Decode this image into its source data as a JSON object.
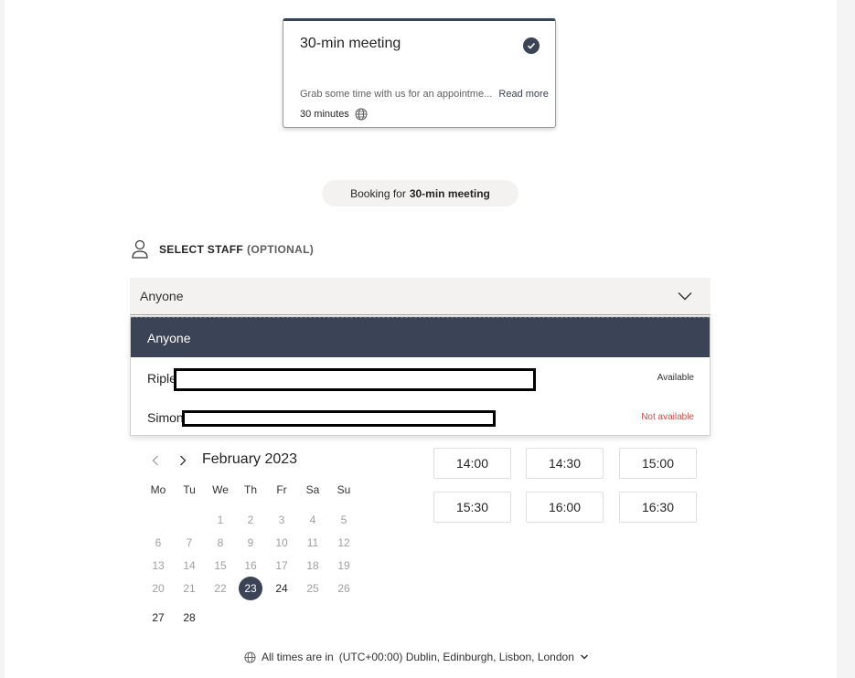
{
  "service": {
    "title": "30-min meeting",
    "description": "Grab some time with us for an appointme...",
    "read_more": "Read more",
    "duration": "30 minutes"
  },
  "booking": {
    "prefix": "Booking for",
    "service_name": "30-min meeting"
  },
  "staff": {
    "title": "SELECT STAFF",
    "optional": "(OPTIONAL)",
    "selected_value": "Anyone",
    "options": [
      {
        "label": "Anyone",
        "status": ""
      },
      {
        "label": "Riple",
        "status": "Available"
      },
      {
        "label": "Simon",
        "status": "Not available"
      }
    ]
  },
  "calendar": {
    "month": "February 2023",
    "weekdays": [
      "Mo",
      "Tu",
      "We",
      "Th",
      "Fr",
      "Sa",
      "Su"
    ],
    "weeks": [
      [
        "",
        "",
        "1",
        "2",
        "3",
        "4",
        "5"
      ],
      [
        "6",
        "7",
        "8",
        "9",
        "10",
        "11",
        "12"
      ],
      [
        "13",
        "14",
        "15",
        "16",
        "17",
        "18",
        "19"
      ],
      [
        "20",
        "21",
        "22",
        "23",
        "24",
        "25",
        "26"
      ],
      [
        "27",
        "28",
        "",
        "",
        "",
        "",
        ""
      ]
    ],
    "selected_day": "23"
  },
  "time_slots": [
    "14:00",
    "14:30",
    "15:00",
    "15:30",
    "16:00",
    "16:30"
  ],
  "timezone": {
    "prefix": "All times are in",
    "value": "(UTC+00:00) Dublin, Edinburgh, Lisbon, London"
  },
  "colors": {
    "accent": "#3b4456",
    "not_available": "#c0504d"
  }
}
